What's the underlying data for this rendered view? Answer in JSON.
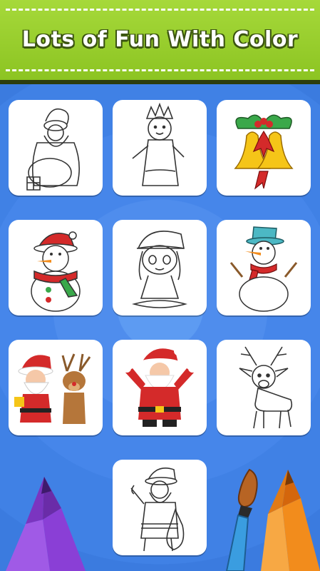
{
  "banner": {
    "title": "Lots of Fun With Color"
  },
  "colors": {
    "banner_green": "#97cf2c",
    "background_blue": "#3f7fe0",
    "tile_white": "#ffffff"
  },
  "gallery": {
    "items": [
      {
        "icon": "santa-with-gift-sack-outline-icon"
      },
      {
        "icon": "snow-princess-outline-icon"
      },
      {
        "icon": "christmas-bells-colored-icon"
      },
      {
        "icon": "snowman-colored-icon"
      },
      {
        "icon": "christmas-girl-outline-icon"
      },
      {
        "icon": "snowman-with-hat-colored-icon"
      },
      {
        "icon": "santa-and-reindeer-colored-icon"
      },
      {
        "icon": "santa-waving-colored-icon"
      },
      {
        "icon": "reindeer-outline-icon"
      },
      {
        "icon": "santa-standing-outline-icon"
      }
    ]
  },
  "decorations": [
    "purple-crayon-icon",
    "paintbrush-icon",
    "orange-crayon-icon"
  ]
}
